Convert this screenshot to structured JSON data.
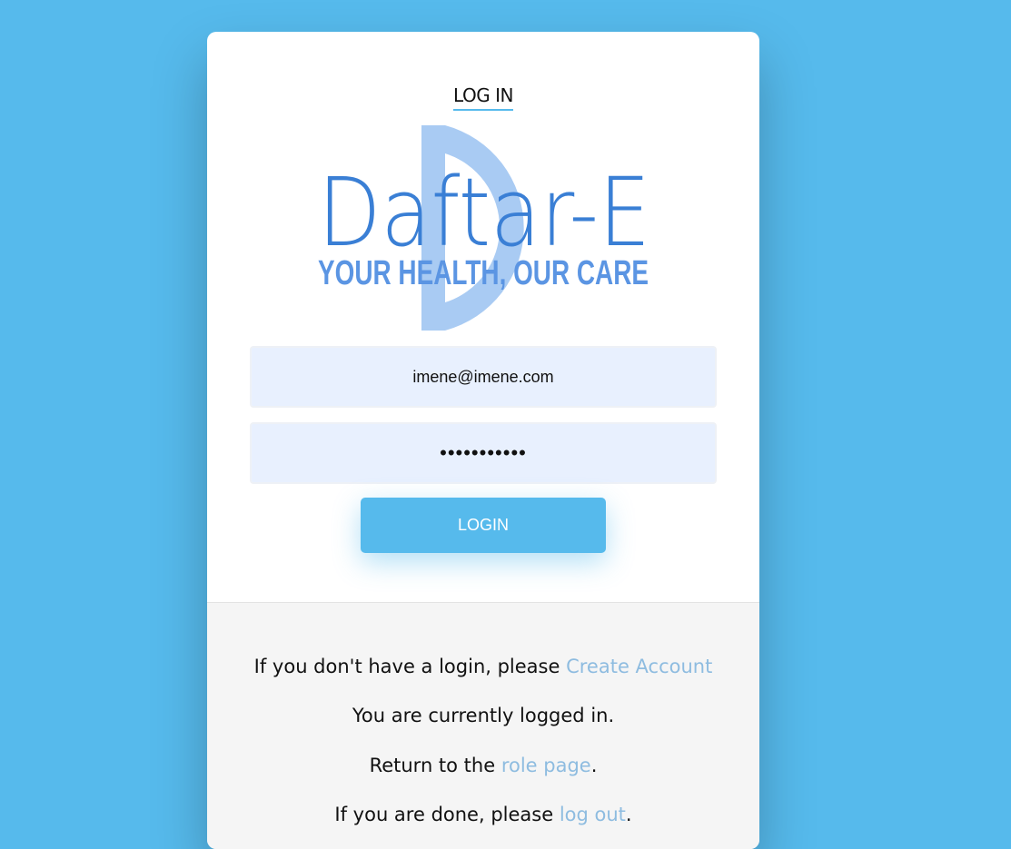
{
  "header": {
    "title": "LOG IN"
  },
  "logo": {
    "name": "Daftar-E",
    "tagline": "YOUR HEALTH, OUR CARE",
    "colors": {
      "text": "#3a7fd5",
      "arc": "#a9cbf3"
    }
  },
  "form": {
    "email_value": "imene@imene.com",
    "password_value": "•••••••••••",
    "login_label": "LOGIN"
  },
  "footer": {
    "line1_text": "If you don't have a login, please ",
    "line1_link": "Create Account",
    "line2_text": "You are currently logged in.",
    "line3_text": "Return to the ",
    "line3_link": "role page",
    "line3_suffix": ".",
    "line4_text": "If you are done, please ",
    "line4_link": "log out",
    "line4_suffix": "."
  },
  "colors": {
    "page_bg": "#56baec",
    "accent": "#56baec",
    "link": "#8ebce0",
    "input_bg": "#e8f0fe"
  }
}
